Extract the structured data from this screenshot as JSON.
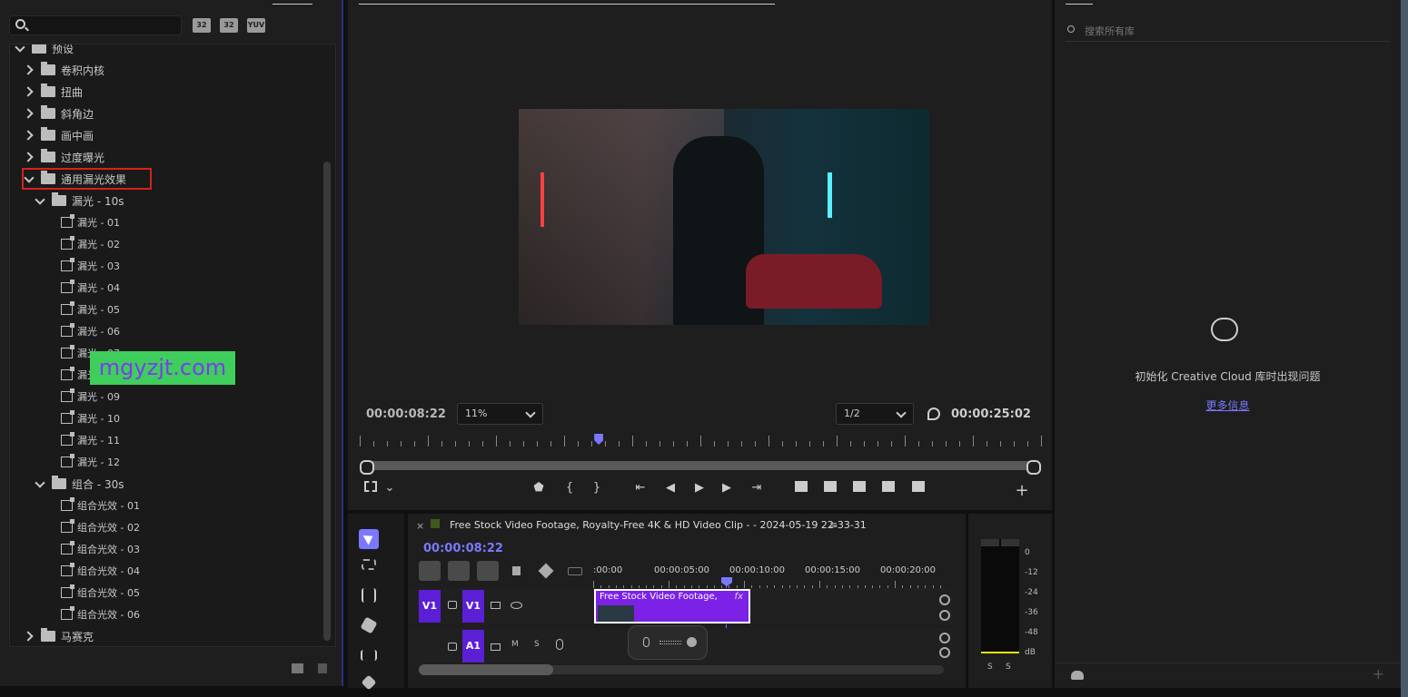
{
  "effects": {
    "search": {
      "placeholder": "",
      "value": ""
    },
    "header_icons": [
      "32-bit-icon",
      "32-icon",
      "yuv-icon"
    ],
    "header_icon_labels": [
      "32",
      "32",
      "YUV"
    ],
    "tree": [
      {
        "label": "预设",
        "level": 0,
        "state": "expanded",
        "kind": "folder"
      },
      {
        "label": "卷积内核",
        "level": 1,
        "state": "collapsed",
        "kind": "folder"
      },
      {
        "label": "扭曲",
        "level": 1,
        "state": "collapsed",
        "kind": "folder"
      },
      {
        "label": "斜角边",
        "level": 1,
        "state": "collapsed",
        "kind": "folder"
      },
      {
        "label": "画中画",
        "level": 1,
        "state": "collapsed",
        "kind": "folder"
      },
      {
        "label": "过度曝光",
        "level": 1,
        "state": "collapsed",
        "kind": "folder"
      },
      {
        "label": "通用漏光效果",
        "level": 1,
        "state": "expanded",
        "kind": "folder",
        "highlight": true
      },
      {
        "label": "漏光 - 10s",
        "level": 2,
        "state": "expanded",
        "kind": "folder"
      },
      {
        "label": "漏光 - 01",
        "level": 3,
        "kind": "preset"
      },
      {
        "label": "漏光 - 02",
        "level": 3,
        "kind": "preset"
      },
      {
        "label": "漏光 - 03",
        "level": 3,
        "kind": "preset"
      },
      {
        "label": "漏光 - 04",
        "level": 3,
        "kind": "preset"
      },
      {
        "label": "漏光 - 05",
        "level": 3,
        "kind": "preset"
      },
      {
        "label": "漏光 - 06",
        "level": 3,
        "kind": "preset"
      },
      {
        "label": "漏光 - 07",
        "level": 3,
        "kind": "preset"
      },
      {
        "label": "漏光 - 08",
        "level": 3,
        "kind": "preset"
      },
      {
        "label": "漏光 - 09",
        "level": 3,
        "kind": "preset"
      },
      {
        "label": "漏光 - 10",
        "level": 3,
        "kind": "preset"
      },
      {
        "label": "漏光 - 11",
        "level": 3,
        "kind": "preset"
      },
      {
        "label": "漏光 - 12",
        "level": 3,
        "kind": "preset"
      },
      {
        "label": "组合 - 30s",
        "level": 2,
        "state": "expanded",
        "kind": "folder"
      },
      {
        "label": "组合光效 - 01",
        "level": 3,
        "kind": "preset"
      },
      {
        "label": "组合光效 - 02",
        "level": 3,
        "kind": "preset"
      },
      {
        "label": "组合光效 - 03",
        "level": 3,
        "kind": "preset"
      },
      {
        "label": "组合光效 - 04",
        "level": 3,
        "kind": "preset"
      },
      {
        "label": "组合光效 - 05",
        "level": 3,
        "kind": "preset"
      },
      {
        "label": "组合光效 - 06",
        "level": 3,
        "kind": "preset"
      },
      {
        "label": "马赛克",
        "level": 1,
        "state": "collapsed",
        "kind": "folder"
      }
    ],
    "watermark": "mgyzjt.com",
    "footer_icons": [
      "new-bin-icon",
      "delete-icon"
    ]
  },
  "program": {
    "current_time": "00:00:08:22",
    "zoom": "11%",
    "resolution": "1/2",
    "duration": "00:00:25:02",
    "playhead_fraction": 0.35,
    "colors": {
      "timecode": "#7a78ff"
    }
  },
  "timeline": {
    "sequence_name": "Free Stock Video Footage, Royalty-Free 4K & HD Video Clip -  - 2024-05-19 22-33-31",
    "current_time": "00:00:08:22",
    "ruler_labels": [
      ":00:00",
      "00:00:05:00",
      "00:00:10:00",
      "00:00:15:00",
      "00:00:20:00"
    ],
    "video_track": {
      "source": "V1",
      "target": "V1"
    },
    "audio_track": {
      "target": "A1",
      "mute": "M",
      "solo": "S"
    },
    "clip_label": "Free Stock Video Footage, ...",
    "clip_fx": "fx",
    "colors": {
      "clip": "#7b22e6",
      "track_button": "#5b1fd6"
    }
  },
  "meter": {
    "labels": [
      "0",
      "-12",
      "-24",
      "-36",
      "-48",
      "dB"
    ],
    "solo": [
      "S",
      "S"
    ]
  },
  "libraries": {
    "search": {
      "placeholder": "搜索所有库"
    },
    "error": "初始化 Creative Cloud 库时出现问题",
    "link": "更多信息",
    "colors": {
      "link": "#7a78ff"
    }
  }
}
